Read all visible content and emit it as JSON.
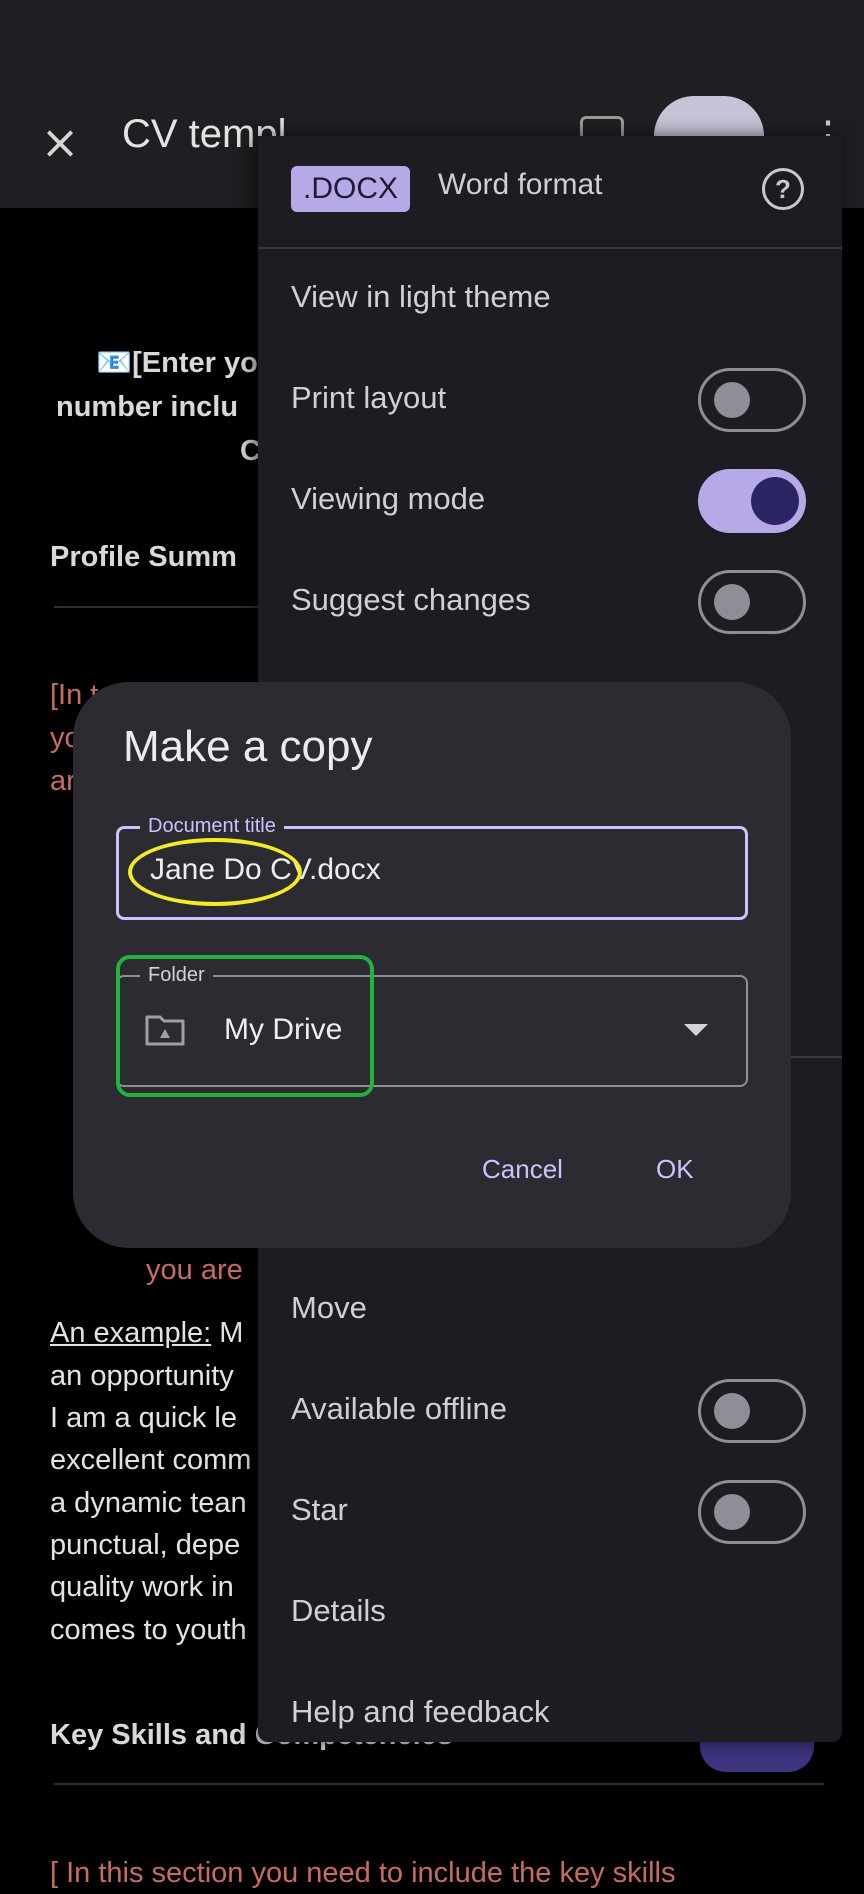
{
  "app_bar": {
    "title": "CV templ",
    "close_icon": "×",
    "more_icon": "⋮"
  },
  "document": {
    "line1": "📧[Enter yo",
    "line2": "number inclu",
    "line3": "C",
    "profile_heading": "Profile Summ",
    "red_1": "[In t",
    "red_2": "yo",
    "red_3": "ar",
    "red_you_are": "you are",
    "example_label": "An example:",
    "example_rest": " M",
    "para_lines": [
      "an opportunity",
      "I am a quick le",
      "excellent comm",
      "a dynamic tean",
      "punctual, depe",
      "quality work in",
      "comes to youth"
    ],
    "key_skills_heading": "Key Skills and Competencies",
    "bottom_red": "[ In this section you need to include the key skills"
  },
  "menu": {
    "badge": ".DOCX",
    "format_label": "Word format",
    "help_icon": "?",
    "items": [
      {
        "label": "View in light theme"
      },
      {
        "label": "Print layout",
        "toggle": false
      },
      {
        "label": "Viewing mode",
        "toggle": true
      },
      {
        "label": "Suggest changes",
        "toggle": false
      },
      {
        "label": "Move"
      },
      {
        "label": "Available offline",
        "toggle": false
      },
      {
        "label": "Star",
        "toggle": false
      },
      {
        "label": "Details"
      },
      {
        "label": "Help and feedback"
      }
    ]
  },
  "dialog": {
    "title": "Make a copy",
    "title_field_label": "Document title",
    "title_field_value": "Jane Do CV.docx",
    "folder_label": "Folder",
    "folder_value": "My Drive",
    "cancel": "Cancel",
    "ok": "OK"
  },
  "colors": {
    "accent": "#cbc3ff",
    "title_highlight": "#f4ec1e",
    "folder_highlight": "#23b23b",
    "toggle_on": "#b7a9e8"
  }
}
